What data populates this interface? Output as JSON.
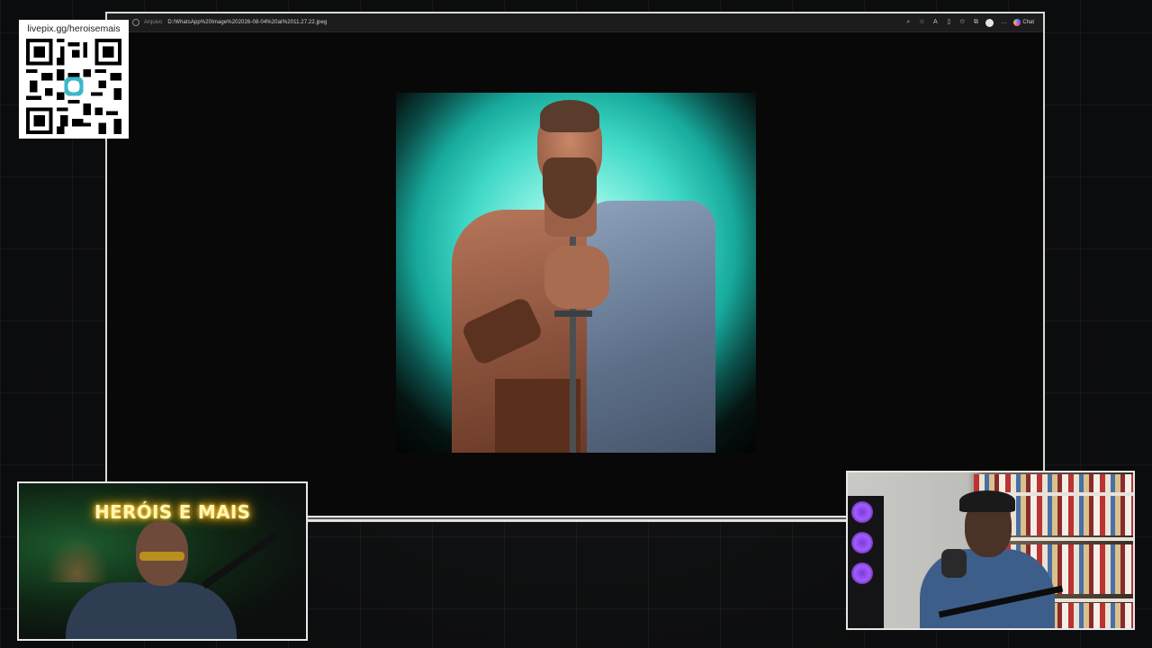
{
  "overlay": {
    "qr_caption": "livepix.gg/heroisemais"
  },
  "browser": {
    "address_label": "Arquivo",
    "address_url": "D:/WhatsApp%20Image%202026-08-04%20at%2011.27.22.jpeg",
    "copilot_label": "Chat",
    "toolbar_icons": [
      "zoom-icon",
      "star-icon",
      "read-aloud-icon",
      "split-screen-icon",
      "favorites-icon",
      "collections-icon",
      "profile-avatar",
      "more-icon",
      "copilot-icon"
    ]
  },
  "webcam_left": {
    "sign_text": "HERÓIS E MAIS"
  },
  "colors": {
    "image_bg": "#3fd8c6",
    "neon_sign": "#ffd65c",
    "browser_border": "#d9d9d9"
  }
}
